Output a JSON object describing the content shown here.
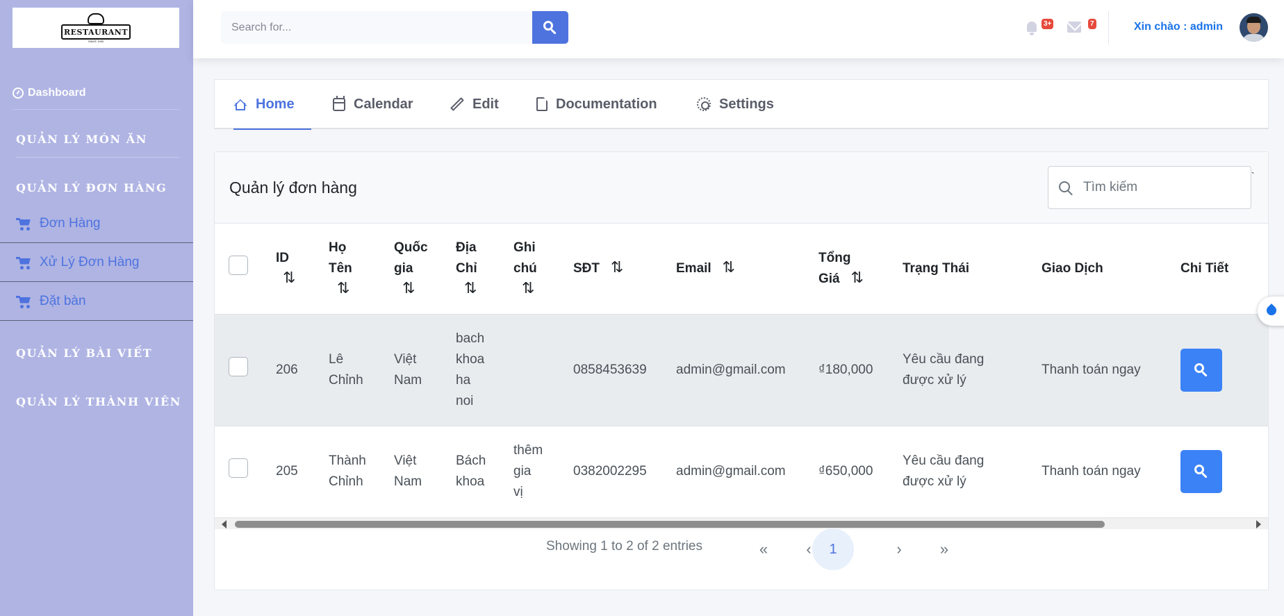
{
  "logo": {
    "text": "RESTAURANT",
    "subtext": "SINCE 1990"
  },
  "sidebar": {
    "dashboard": "Dashboard",
    "sections": {
      "mon_an": "QUẢN LÝ MÓN ĂN",
      "don_hang": "QUẢN LÝ ĐƠN HÀNG",
      "bai_viet": "QUẢN LÝ BÀI VIẾT",
      "thanh_vien": "QUẢN LÝ THÀNH VIÊN"
    },
    "items": [
      "Đơn Hàng",
      "Xử Lý Đơn Hàng",
      "Đặt bàn"
    ]
  },
  "topbar": {
    "search_placeholder": "Search for...",
    "alerts_badge": "3+",
    "messages_badge": "7",
    "greeting": "Xin chào : admin"
  },
  "tabs": [
    "Home",
    "Calendar",
    "Edit",
    "Documentation",
    "Settings"
  ],
  "table": {
    "title": "Quản lý đơn hàng",
    "search_placeholder": "Tìm kiếm",
    "headers": {
      "id": "ID",
      "ho_ten": [
        "Họ",
        "Tên"
      ],
      "quoc_gia": [
        "Quốc",
        "gia"
      ],
      "dia_chi": [
        "Địa",
        "Chỉ"
      ],
      "ghi_chu": [
        "Ghi",
        "chú"
      ],
      "sdt": "SĐT",
      "email": "Email",
      "tong_gia": [
        "Tổng",
        "Giá"
      ],
      "trang_thai": "Trạng Thái",
      "giao_dich": "Giao Dịch",
      "chi_tiet": "Chi Tiết"
    },
    "sort_icon": "⇅",
    "rows": [
      {
        "id": "206",
        "ho_ten": [
          "Lê",
          "Chỉnh"
        ],
        "quoc_gia": [
          "Việt",
          "Nam"
        ],
        "dia_chi": [
          "bach",
          "khoa",
          "ha",
          "noi"
        ],
        "ghi_chu": [],
        "sdt": "0858453639",
        "email": "admin@gmail.com",
        "tong_gia": "₫180,000",
        "trang_thai": [
          "Yêu cầu đang",
          "được xử lý"
        ],
        "giao_dich": "Thanh toán ngay"
      },
      {
        "id": "205",
        "ho_ten": [
          "Thành",
          "Chỉnh"
        ],
        "quoc_gia": [
          "Việt",
          "Nam"
        ],
        "dia_chi": [
          "Bách",
          "khoa"
        ],
        "ghi_chu": [
          "thêm",
          "gia",
          "vị"
        ],
        "sdt": "0382002295",
        "email": "admin@gmail.com",
        "tong_gia": "₫650,000",
        "trang_thai": [
          "Yêu cầu đang",
          "được xử lý"
        ],
        "giao_dich": "Thanh toán ngay"
      }
    ],
    "showing": "Showing 1 to 2 of 2 entries",
    "pagination": {
      "first": "«",
      "prev": "‹",
      "current": "1",
      "next": "›",
      "last": "»"
    }
  },
  "colors": {
    "sidebar_bg": "#afb4e3",
    "accent": "#4e73df",
    "badge": "#e74a3b",
    "detail_button": "#3b82f6"
  },
  "icons": [
    "dashboard-icon",
    "cart-icon",
    "search-icon",
    "bell-icon",
    "envelope-icon",
    "home-icon",
    "calendar-icon",
    "pencil-icon",
    "file-icon",
    "gear-icon",
    "sort-icon"
  ]
}
